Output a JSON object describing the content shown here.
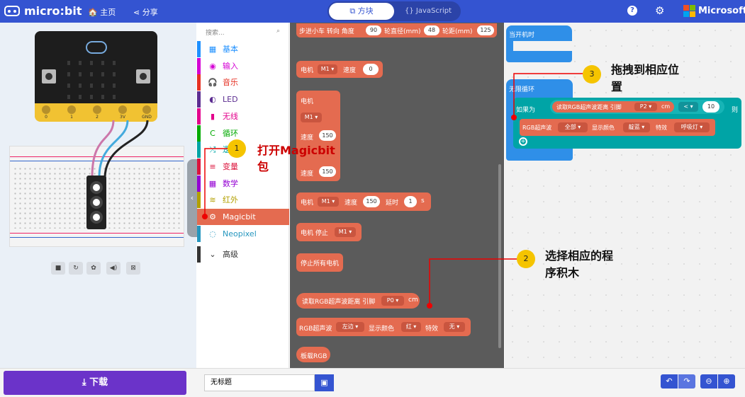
{
  "topbar": {
    "brand": "micro:bit",
    "home": "主页",
    "share": "分享",
    "tab_blocks": "方块",
    "tab_js": "{} JavaScript",
    "ms": "Microsoft",
    "help_icon": "question-icon",
    "settings_icon": "gear-icon"
  },
  "simulator": {
    "pins": [
      "0",
      "1",
      "2",
      "3V",
      "GND"
    ]
  },
  "toolbox": {
    "search_placeholder": "搜索...",
    "categories": [
      {
        "label": "基本",
        "color": "#1e90ff",
        "icon": "▦"
      },
      {
        "label": "输入",
        "color": "#d400d4",
        "icon": "◉"
      },
      {
        "label": "音乐",
        "color": "#e63022",
        "icon": "🎧"
      },
      {
        "label": "LED",
        "color": "#5c2d91",
        "icon": "◐"
      },
      {
        "label": "无线",
        "color": "#e3008c",
        "icon": "▮"
      },
      {
        "label": "循环",
        "color": "#00aa00",
        "icon": "C"
      },
      {
        "label": "逻辑",
        "color": "#00a4a6",
        "icon": "⤮"
      },
      {
        "label": "变量",
        "color": "#dc143c",
        "icon": "≡"
      },
      {
        "label": "数学",
        "color": "#9400d3",
        "icon": "▦"
      },
      {
        "label": "红外",
        "color": "#b3a000",
        "icon": "≋"
      },
      {
        "label": "Magicbit",
        "color": "#e46b50",
        "icon": "⚙"
      },
      {
        "label": "Neopixel",
        "color": "#2596be",
        "icon": "◌"
      },
      {
        "label": "高级",
        "color": "#333333",
        "icon": "⌄"
      }
    ]
  },
  "flyout": {
    "b1": {
      "a": "步进小车 转向 角度",
      "v1": "90",
      "b": "轮直径(mm)",
      "v2": "48",
      "c": "轮距(mm)",
      "v3": "125"
    },
    "b2": {
      "a": "电机",
      "dd": "M1 ▾",
      "b": "速度",
      "v": "0"
    },
    "b3": {
      "a": "电机",
      "dd": "M1 ▾",
      "b": "速度",
      "v": "150",
      "c": "速度",
      "v2": "150"
    },
    "b4": {
      "a": "电机",
      "dd": "M1 ▾",
      "b": "速度",
      "v": "150",
      "c": "延时",
      "v2": "1",
      "d": "s"
    },
    "b5": {
      "a": "电机 停止",
      "dd": "M1 ▾"
    },
    "b6": {
      "a": "停止所有电机"
    },
    "b7": {
      "a": "读取RGB超声波距离 引脚",
      "dd": "P0 ▾",
      "b": "cm"
    },
    "b8": {
      "a": "RGB超声波",
      "dd1": "左边 ▾",
      "b": "显示颜色",
      "dd2": "红 ▾",
      "c": "特效",
      "dd3": "无 ▾"
    },
    "b9": {
      "a": "板载RGB"
    }
  },
  "workspace": {
    "on_start": "当开机时",
    "forever": "无限循环",
    "if": "如果为",
    "read": "读取RGB超声波距离 引脚",
    "pin": "P2 ▾",
    "unit": "cm",
    "op": "< ▾",
    "val": "10",
    "then": "则",
    "rgb": "RGB超声波",
    "all": "全部 ▾",
    "color_lbl": "显示颜色",
    "color": "靛蓝 ▾",
    "effect_lbl": "特效",
    "effect": "呼吸灯 ▾"
  },
  "annotations": {
    "n1": "1",
    "t1a": "打开Magicbit",
    "t1b": "包",
    "n2": "2",
    "t2a": "选择相应的程",
    "t2b": "序积木",
    "n3": "3",
    "t3a": "拖拽到相应位",
    "t3b": "置"
  },
  "bottom": {
    "download": "下载",
    "project_name": "无标题"
  }
}
